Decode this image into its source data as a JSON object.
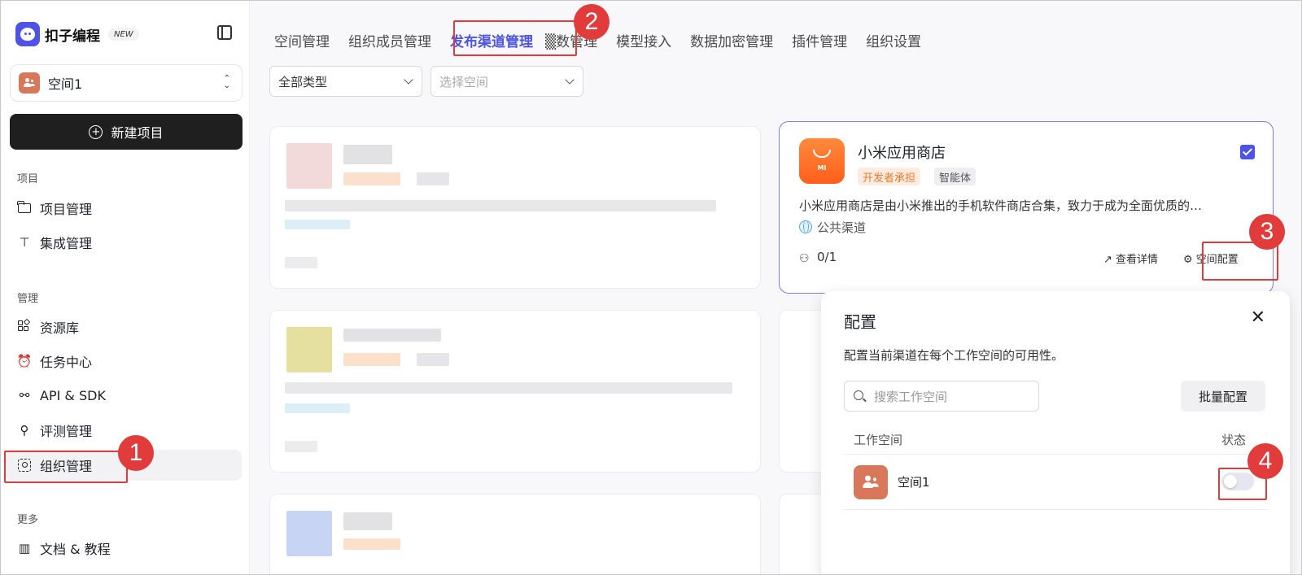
{
  "brand": {
    "name": "扣子编程",
    "badge": "NEW"
  },
  "space_selector": {
    "name": "空间1"
  },
  "new_project": {
    "label": "新建项目"
  },
  "sidebar": {
    "section_project": "项目",
    "section_manage": "管理",
    "section_more": "更多",
    "items": [
      {
        "label": "项目管理"
      },
      {
        "label": "集成管理"
      },
      {
        "label": "资源库"
      },
      {
        "label": "任务中心"
      },
      {
        "label": "API & SDK"
      },
      {
        "label": "评测管理"
      },
      {
        "label": "组织管理"
      },
      {
        "label": "文档 & 教程"
      }
    ]
  },
  "tabs": [
    {
      "label": "空间管理"
    },
    {
      "label": "组织成员管理"
    },
    {
      "label": "发布渠道管理"
    },
    {
      "label": "▒数管理"
    },
    {
      "label": "模型接入"
    },
    {
      "label": "数据加密管理"
    },
    {
      "label": "插件管理"
    },
    {
      "label": "组织设置"
    }
  ],
  "filters": {
    "type": "全部类型",
    "space_placeholder": "选择空间"
  },
  "channel_card": {
    "title": "小米应用商店",
    "tag_cost": "开发者承担",
    "tag_type": "智能体",
    "description": "小米应用商店是由小米推出的手机软件商店合集，致力于成为全面优质的…",
    "visibility": "公共渠道",
    "count": "0/1",
    "detail_label": "查看详情",
    "config_label": "空间配置",
    "icon_text": "MI"
  },
  "modal": {
    "title": "配置",
    "description": "配置当前渠道在每个工作空间的可用性。",
    "search_placeholder": "搜索工作空间",
    "batch_label": "批量配置",
    "col_space": "工作空间",
    "col_status": "状态",
    "rows": [
      {
        "name": "空间1",
        "enabled": false
      }
    ]
  },
  "annotations": {
    "step1": "1",
    "step2": "2",
    "step3": "3",
    "step4": "4"
  },
  "colors": {
    "accent": "#4d53e8",
    "annotation": "#e23b3b",
    "space_avatar": "#d9775a"
  }
}
